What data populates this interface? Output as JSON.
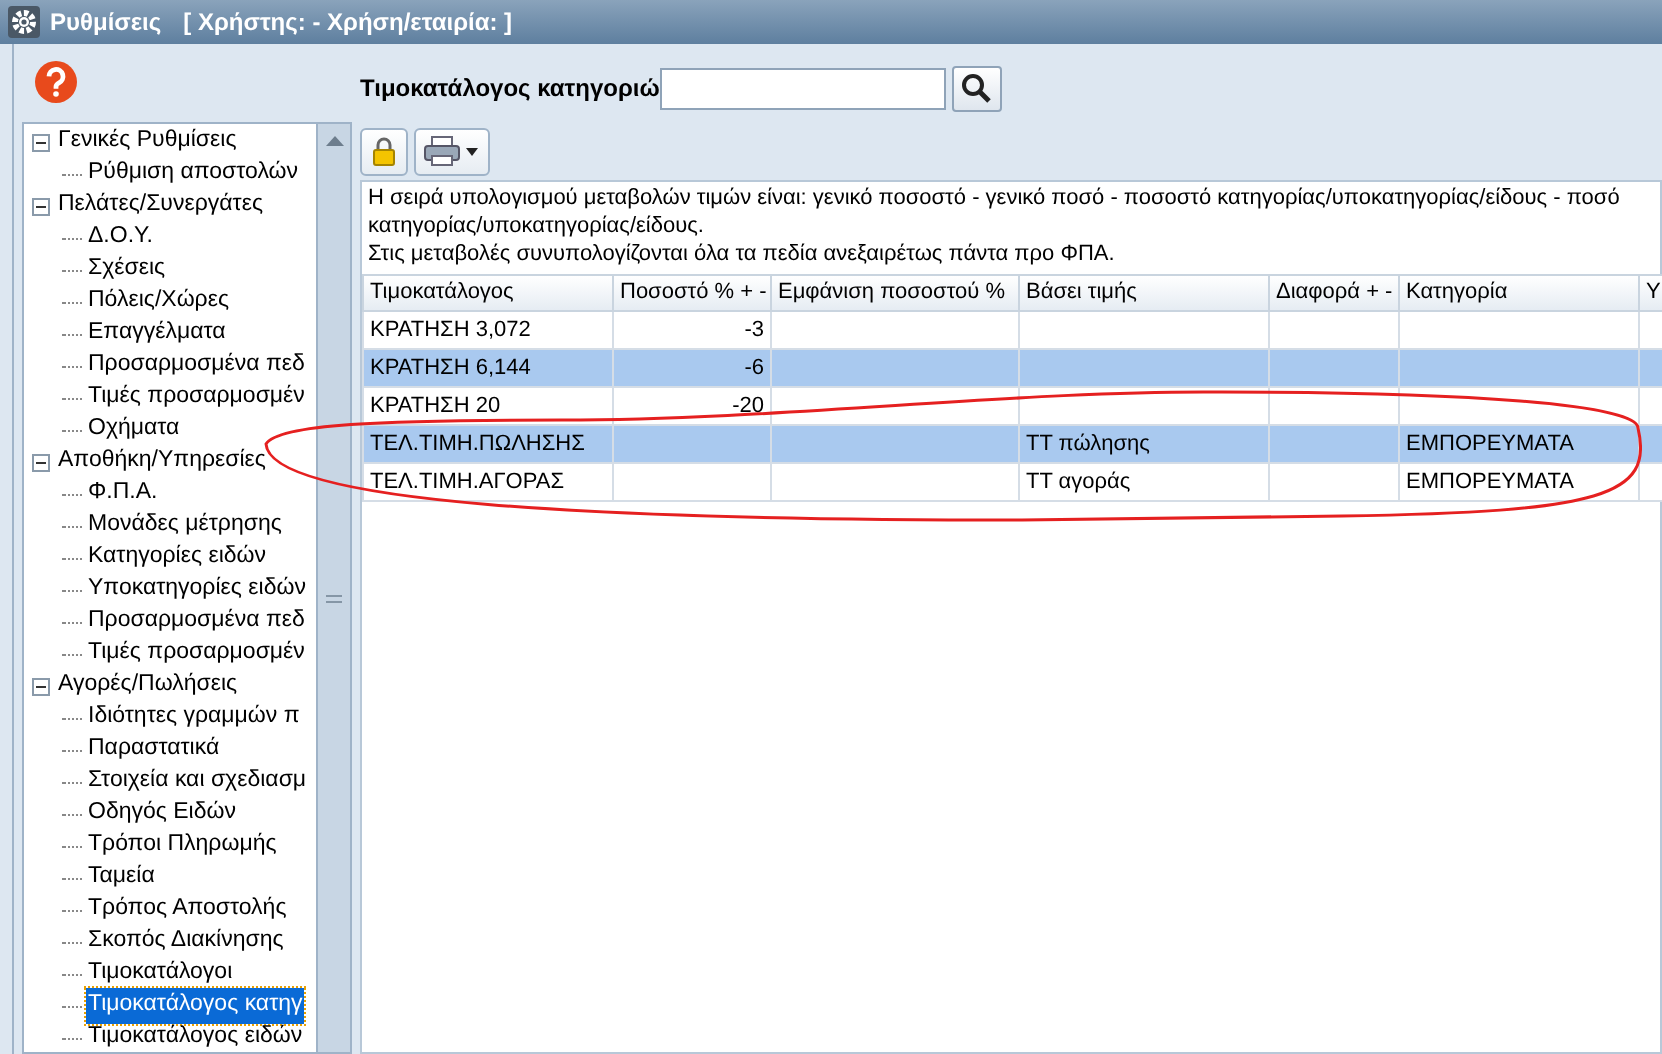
{
  "window": {
    "title": "Ρυθμίσεις",
    "subtitle": "[ Χρήστης: - Χρήση/εταιρία: ]"
  },
  "search": {
    "label": "Τιμοκατάλογος κατηγοριώ"
  },
  "tree": [
    {
      "label": "Γενικές Ρυθμίσεις",
      "expanded": true,
      "selected": false,
      "children": [
        {
          "label": "Ρύθμιση αποστολών",
          "selected": false
        }
      ]
    },
    {
      "label": "Πελάτες/Συνεργάτες",
      "expanded": true,
      "selected": false,
      "children": [
        {
          "label": "Δ.Ο.Υ.",
          "selected": false
        },
        {
          "label": "Σχέσεις",
          "selected": false
        },
        {
          "label": "Πόλεις/Χώρες",
          "selected": false
        },
        {
          "label": "Επαγγέλματα",
          "selected": false
        },
        {
          "label": "Προσαρμοσμένα πεδ",
          "selected": false
        },
        {
          "label": "Τιμές προσαρμοσμέν",
          "selected": false
        },
        {
          "label": "Οχήματα",
          "selected": false
        }
      ]
    },
    {
      "label": "Αποθήκη/Υπηρεσίες",
      "expanded": true,
      "selected": false,
      "children": [
        {
          "label": "Φ.Π.Α.",
          "selected": false
        },
        {
          "label": "Μονάδες μέτρησης",
          "selected": false
        },
        {
          "label": "Κατηγορίες ειδών",
          "selected": false
        },
        {
          "label": "Υποκατηγορίες ειδών",
          "selected": false
        },
        {
          "label": "Προσαρμοσμένα πεδ",
          "selected": false
        },
        {
          "label": "Τιμές προσαρμοσμέν",
          "selected": false
        }
      ]
    },
    {
      "label": "Αγορές/Πωλήσεις",
      "expanded": true,
      "selected": false,
      "children": [
        {
          "label": "Ιδιότητες γραμμών π",
          "selected": false
        },
        {
          "label": "Παραστατικά",
          "selected": false
        },
        {
          "label": "Στοιχεία και σχεδιασμ",
          "selected": false
        },
        {
          "label": "Οδηγός Ειδών",
          "selected": false
        },
        {
          "label": "Τρόποι Πληρωμής",
          "selected": false
        },
        {
          "label": "Ταμεία",
          "selected": false
        },
        {
          "label": "Τρόπος Αποστολής",
          "selected": false
        },
        {
          "label": "Σκοπός Διακίνησης",
          "selected": false
        },
        {
          "label": "Τιμοκατάλογοι",
          "selected": false
        },
        {
          "label": "Τιμοκατάλογος κατηγ",
          "selected": true
        },
        {
          "label": "Τιμοκατάλογος ειδών",
          "selected": false
        }
      ]
    }
  ],
  "info": [
    "Η σειρά υπολογισμού μεταβολών τιμών είναι: γενικό ποσοστό - γενικό ποσό - ποσοστό κατηγορίας/υποκατηγορίας/είδους - ποσό κατηγορίας/υποκατηγορίας/είδους.",
    "Στις μεταβολές συνυπολογίζονται όλα τα πεδία ανεξαιρέτως πάντα προ ΦΠΑ."
  ],
  "table": {
    "columns": [
      "Τιμοκατάλογος",
      "Ποσοστό % + -",
      "Εμφάνιση ποσοστού %",
      "Βάσει τιμής",
      "Διαφορά + -",
      "Κατηγορία",
      "Υ"
    ],
    "rows": [
      [
        "ΚΡΑΤΗΣΗ 3,072",
        "-3",
        "",
        "",
        "",
        "",
        ""
      ],
      [
        "ΚΡΑΤΗΣΗ 6,144",
        "-6",
        "",
        "",
        "",
        "",
        ""
      ],
      [
        "ΚΡΑΤΗΣΗ 20",
        "-20",
        "",
        "",
        "",
        "",
        ""
      ],
      [
        "ΤΕΛ.ΤΙΜΗ.ΠΩΛΗΣΗΣ",
        "",
        "",
        "ΤΤ πώλησης",
        "",
        "ΕΜΠΟΡΕΥΜΑΤΑ",
        ""
      ],
      [
        "ΤΕΛ.ΤΙΜΗ.ΑΓΟΡΑΣ",
        "",
        "",
        "ΤΤ αγοράς",
        "",
        "ΕΜΠΟΡΕΥΜΑΤΑ",
        ""
      ]
    ]
  }
}
